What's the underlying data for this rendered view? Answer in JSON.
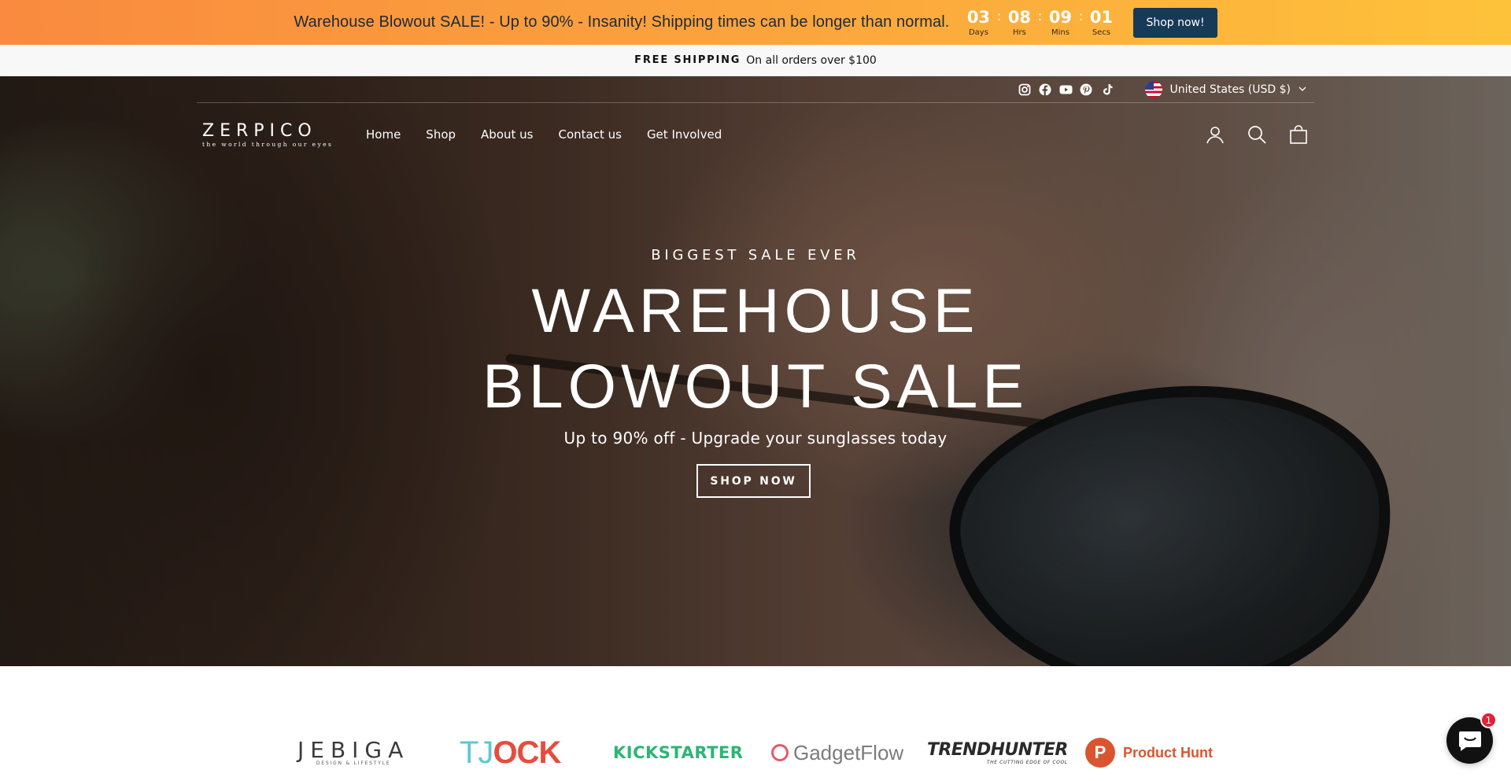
{
  "promo": {
    "text": "Warehouse Blowout SALE! - Up to 90% - Insanity! Shipping times can be longer than normal.",
    "countdown": [
      {
        "value": "03",
        "label": "Days"
      },
      {
        "value": "08",
        "label": "Hrs"
      },
      {
        "value": "09",
        "label": "Mins"
      },
      {
        "value": "01",
        "label": "Secs"
      }
    ],
    "separator": ":",
    "button": "Shop now!",
    "gradient": [
      "#f98a3f",
      "#fec23a"
    ],
    "button_color": "#173a56"
  },
  "shipping": {
    "strong": "FREE SHIPPING",
    "text": "On all orders over $100"
  },
  "header": {
    "socials": [
      "instagram-icon",
      "facebook-icon",
      "youtube-icon",
      "pinterest-icon",
      "tiktok-icon"
    ],
    "currency": "United States (USD $)",
    "logo_main": "ZERPICO",
    "logo_tagline": "the world through our eyes",
    "nav": [
      "Home",
      "Shop",
      "About us",
      "Contact us",
      "Get Involved"
    ],
    "icons": [
      "account-icon",
      "search-icon",
      "cart-icon"
    ]
  },
  "hero": {
    "kicker": "BIGGEST SALE EVER",
    "headline_line1": "WAREHOUSE",
    "headline_line2": "BLOWOUT SALE",
    "subline": "Up to 90% off - Upgrade your sunglasses today",
    "button": "SHOP NOW"
  },
  "press": {
    "jebiga": "JEBIGA",
    "jebiga_sub": "DESIGN & LIFESTYLE",
    "tjock_a": "TJ",
    "tjock_b": "OCK",
    "kickstarter": "KICKSTARTER",
    "gadgetflow": "GadgetFlow",
    "trendhunter": "TRENDHUNTER",
    "trendhunter_sub": "THE CUTTING EDGE OF COOL",
    "producthunt_mark": "P",
    "producthunt": "Product Hunt"
  },
  "chat": {
    "badge": "1"
  }
}
